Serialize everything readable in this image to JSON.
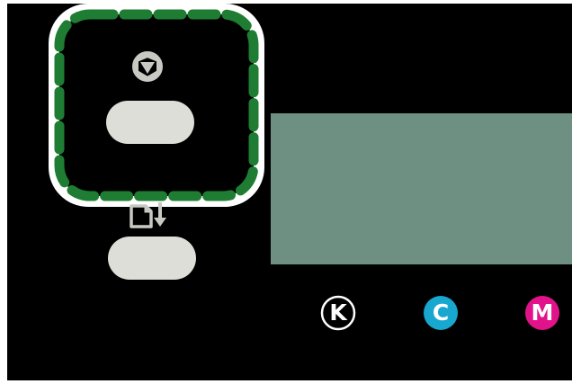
{
  "control_panel": {
    "stop_button": {
      "icon": "stop-icon",
      "highlighted": true,
      "highlight_color": "#1e7d32"
    },
    "copy_button": {
      "icon": "copy-document-icon"
    },
    "display": {
      "color": "#6d9082"
    },
    "ink_indicators": [
      {
        "letter": "K",
        "color": "#000000",
        "text_color": "#ffffff",
        "outlined": true
      },
      {
        "letter": "C",
        "color": "#17a7cf",
        "text_color": "#ffffff",
        "outlined": false
      },
      {
        "letter": "M",
        "color": "#e2138a",
        "text_color": "#ffffff",
        "outlined": false
      }
    ]
  }
}
